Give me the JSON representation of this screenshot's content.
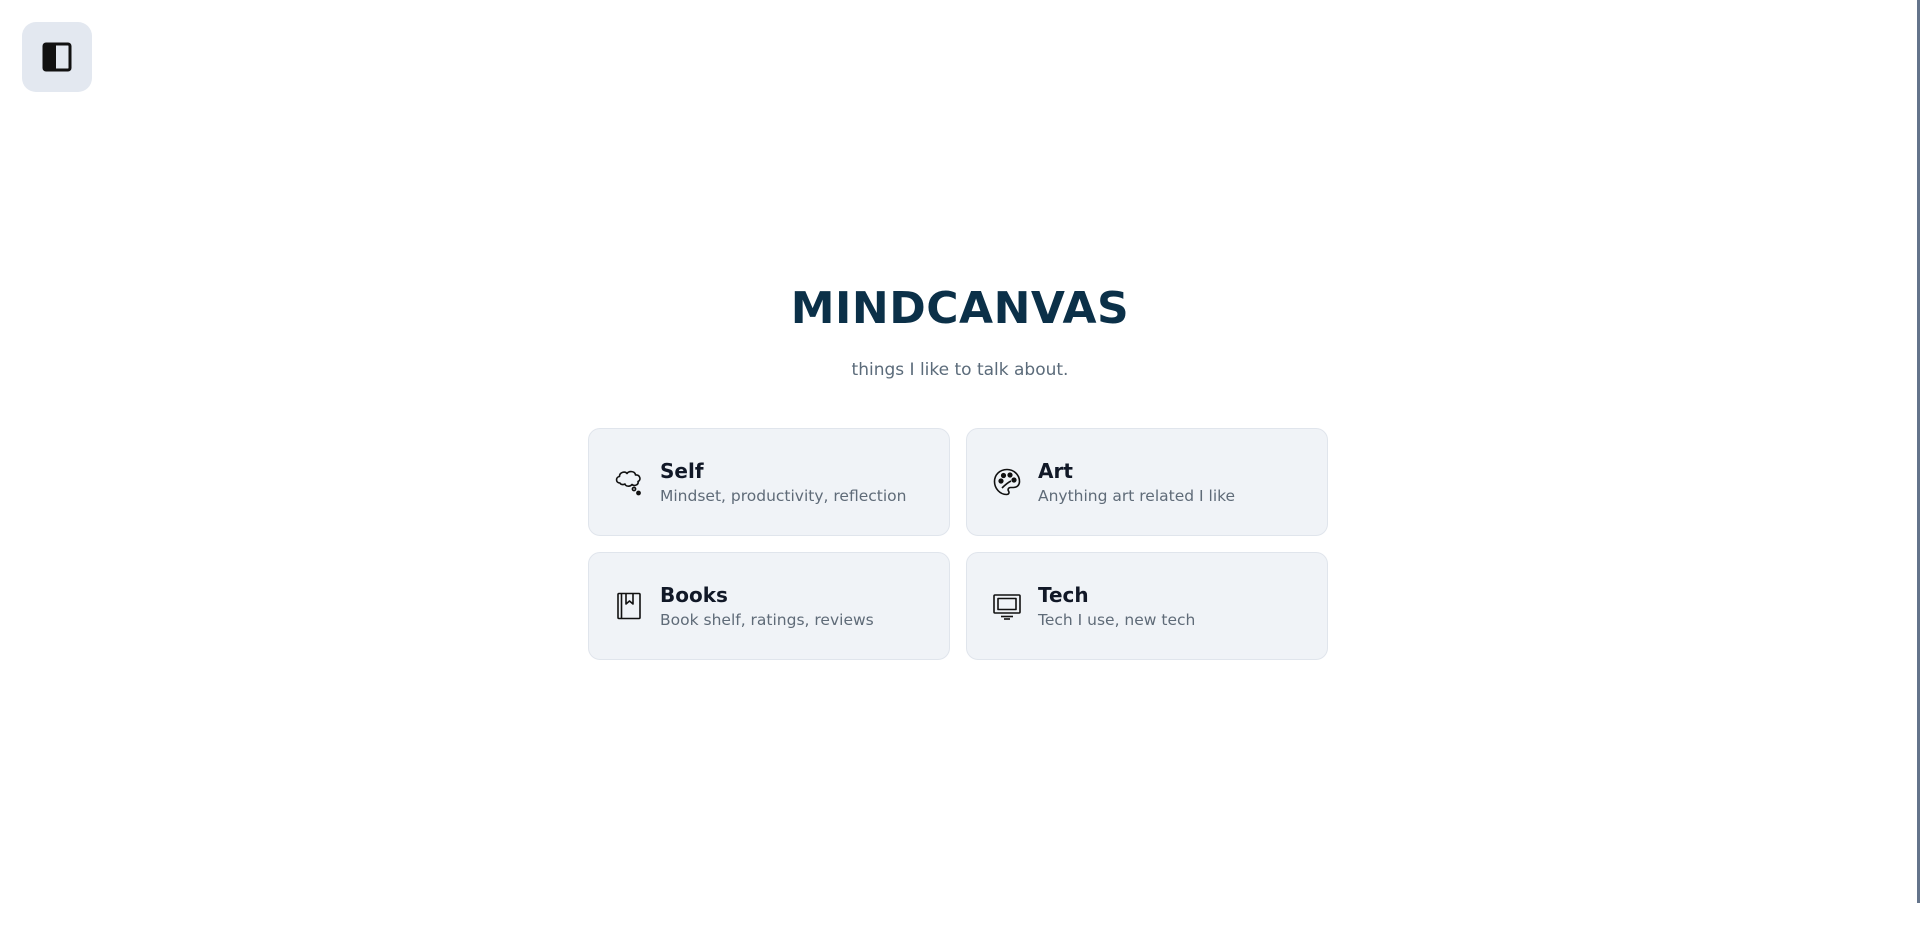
{
  "sidebar_toggle": {
    "icon": "sidebar-toggle-icon"
  },
  "hero": {
    "title": "MINDCANVAS",
    "tagline": "things I like to talk about."
  },
  "categories": [
    {
      "title": "Self",
      "description": "Mindset, productivity, reflection",
      "icon": "thought-bubble-icon"
    },
    {
      "title": "Art",
      "description": "Anything art related I like",
      "icon": "palette-icon"
    },
    {
      "title": "Books",
      "description": "Book shelf, ratings, reviews",
      "icon": "book-bookmark-icon"
    },
    {
      "title": "Tech",
      "description": "Tech I use, new tech",
      "icon": "monitor-icon"
    }
  ],
  "colors": {
    "title": "#0b3048",
    "card_background": "#f0f3f7",
    "toggle_background": "#e3e8f0"
  }
}
